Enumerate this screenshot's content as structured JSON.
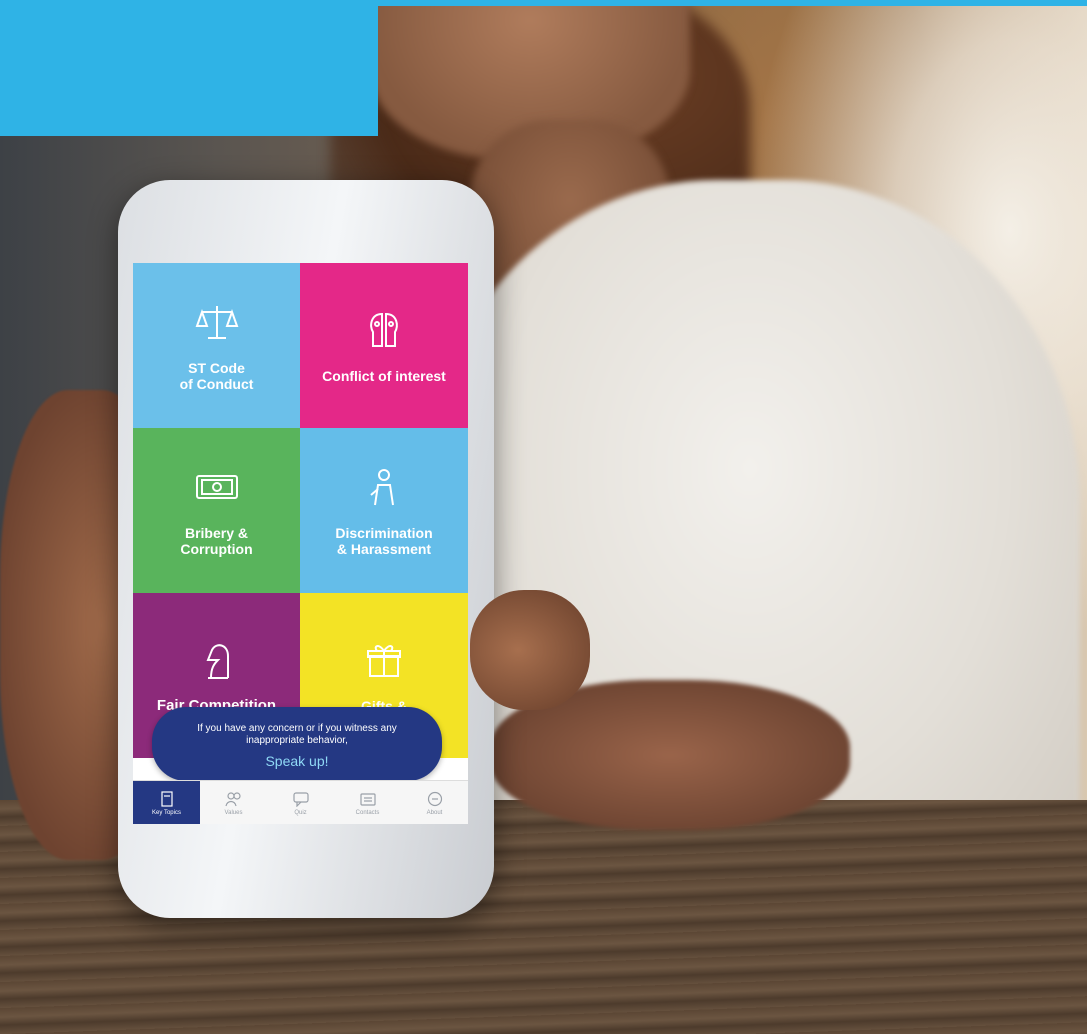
{
  "banner": {
    "color": "#2fb3e6"
  },
  "app": {
    "tiles": [
      {
        "label": "ST Code\nof Conduct",
        "icon": "scales-icon",
        "color": "#6bc0ea"
      },
      {
        "label": "Conflict of interest",
        "icon": "two-heads-icon",
        "color": "#e42888"
      },
      {
        "label": "Bribery &\nCorruption",
        "icon": "banknote-icon",
        "color": "#59b45c"
      },
      {
        "label": "Discrimination\n& Harassment",
        "icon": "person-icon",
        "color": "#64bde9"
      },
      {
        "label": "Fair Competition",
        "icon": "chess-knight-icon",
        "color": "#8c2a7a"
      },
      {
        "label": "Gifts &",
        "icon": "gift-icon",
        "color": "#f3e325"
      }
    ],
    "popup": {
      "message": "If you have any concern or if you witness any inappropriate behavior,",
      "cta": "Speak up!"
    },
    "tabs": [
      {
        "label": "Key Topics",
        "icon": "book-icon",
        "active": true
      },
      {
        "label": "Values",
        "icon": "group-icon",
        "active": false
      },
      {
        "label": "Quiz",
        "icon": "chat-icon",
        "active": false
      },
      {
        "label": "Contacts",
        "icon": "contacts-icon",
        "active": false
      },
      {
        "label": "About",
        "icon": "info-icon",
        "active": false
      }
    ]
  }
}
